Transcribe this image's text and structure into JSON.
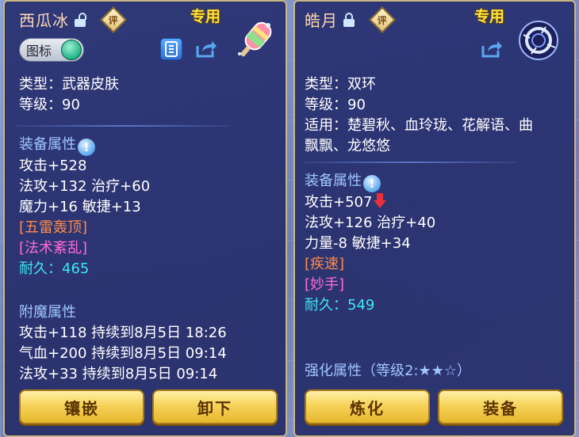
{
  "left_item": {
    "name": "西瓜冰",
    "lock_state": "unlocked",
    "eval_label": "评",
    "exclusive_label": "专用",
    "tag_toggle_label": "图标",
    "type_line": "类型：武器皮肤",
    "level_line": "等级：90",
    "equip_section": "装备属性",
    "hint_glyph": "!",
    "base_stats": [
      "攻击+528",
      "法攻+132 治疗+60",
      "魔力+16 敏捷+13"
    ],
    "special_effects": [
      {
        "text": "[五雷轰顶]",
        "color": "#ff8a4a"
      },
      {
        "text": "[法术紊乱]",
        "color": "#ff6ad8"
      }
    ],
    "durability_label": "耐久：",
    "durability_value": "465",
    "enchant_section": "附魔属性",
    "enchant_stats": [
      "攻击+118 持续到8月5日 18:26",
      "气血+200 持续到8月5日 09:14",
      "法攻+33 持续到8月5日 09:14"
    ],
    "buttons": [
      "镶嵌",
      "卸下"
    ]
  },
  "right_item": {
    "name": "皓月",
    "lock_state": "locked",
    "eval_label": "评",
    "exclusive_label": "专用",
    "type_line": "类型：双环",
    "level_line": "等级：90",
    "usable_line_1": "适用：楚碧秋、血玲珑、花解语、曲",
    "usable_line_2": "飘飘、龙悠悠",
    "equip_section": "装备属性",
    "hint_glyph": "!",
    "base_stats": [
      "攻击+507",
      "法攻+126 治疗+40",
      "力量-8 敏捷+34"
    ],
    "special_effects": [
      {
        "text": "[疾速]",
        "color": "#ff8a4a"
      },
      {
        "text": "[妙手]",
        "color": "#ff6ad8"
      }
    ],
    "durability_label": "耐久：",
    "durability_value": "549",
    "enhance_section": "强化属性（等级2:★★☆）",
    "buttons": [
      "炼化",
      "装备"
    ]
  },
  "colors": {
    "panel_bg": "#252d6e",
    "panel_border": "#c9b98a",
    "section_blue": "#9fc6ff",
    "durability_cyan": "#3fe6f2",
    "exclusive_yellow": "#ffe23a",
    "button_gold": "#f6d25a"
  },
  "icons": [
    "unlocked-lock-icon",
    "locked-lock-icon",
    "info-icon",
    "share-icon",
    "popsicle-item-icon",
    "ring-item-icon",
    "down-arrow-icon"
  ]
}
